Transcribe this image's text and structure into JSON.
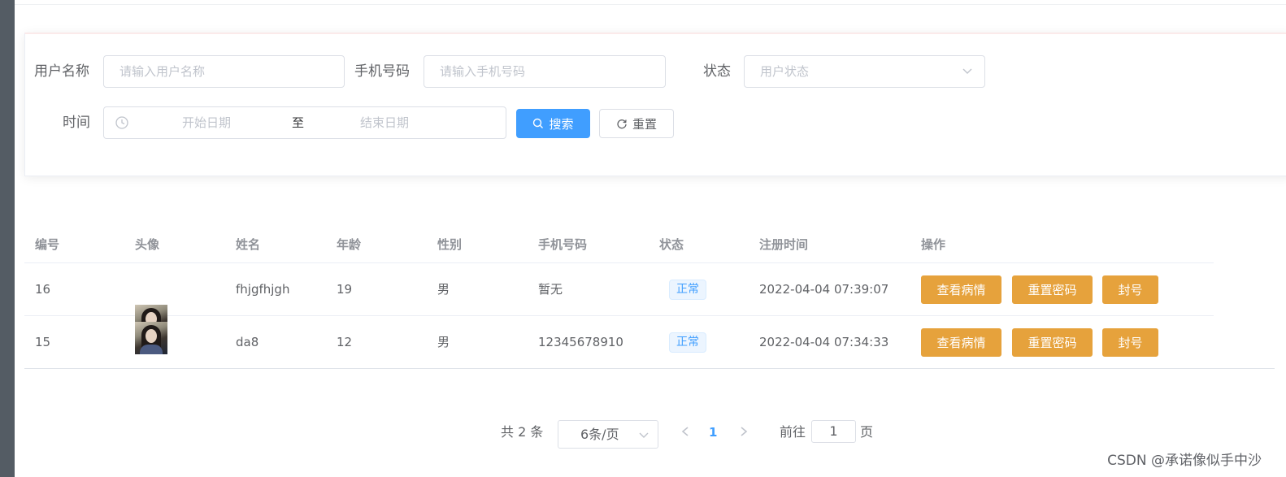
{
  "search": {
    "username_label": "用户名称",
    "username_placeholder": "请输入用户名称",
    "phone_label": "手机号码",
    "phone_placeholder": "请输入手机号码",
    "status_label": "状态",
    "status_placeholder": "用户状态",
    "time_label": "时间",
    "start_placeholder": "开始日期",
    "range_separator": "至",
    "end_placeholder": "结束日期",
    "search_button": "搜索",
    "reset_button": "重置"
  },
  "table": {
    "columns": [
      "编号",
      "头像",
      "姓名",
      "年龄",
      "性别",
      "手机号码",
      "状态",
      "注册时间",
      "操作"
    ],
    "rows": [
      {
        "id": "16",
        "avatar": "avatar-photo",
        "name": "fhjgfhjgh",
        "age": "19",
        "gender": "男",
        "phone": "暂无",
        "status": "正常",
        "registered": "2022-04-04 07:39:07"
      },
      {
        "id": "15",
        "avatar": "avatar-photo",
        "name": "da8",
        "age": "12",
        "gender": "男",
        "phone": "12345678910",
        "status": "正常",
        "registered": "2022-04-04 07:34:33"
      }
    ],
    "actions": [
      "查看病情",
      "重置密码",
      "封号"
    ]
  },
  "pagination": {
    "total_text": "共 2 条",
    "page_size": "6条/页",
    "current_page": "1",
    "goto_label": "前往",
    "goto_value": "1",
    "page_unit": "页"
  },
  "watermark": "CSDN @承诺像似手中沙",
  "colors": {
    "primary": "#409eff",
    "warning": "#e6a23c",
    "sidebar": "#545c64",
    "tag_bg": "#ecf5ff"
  }
}
